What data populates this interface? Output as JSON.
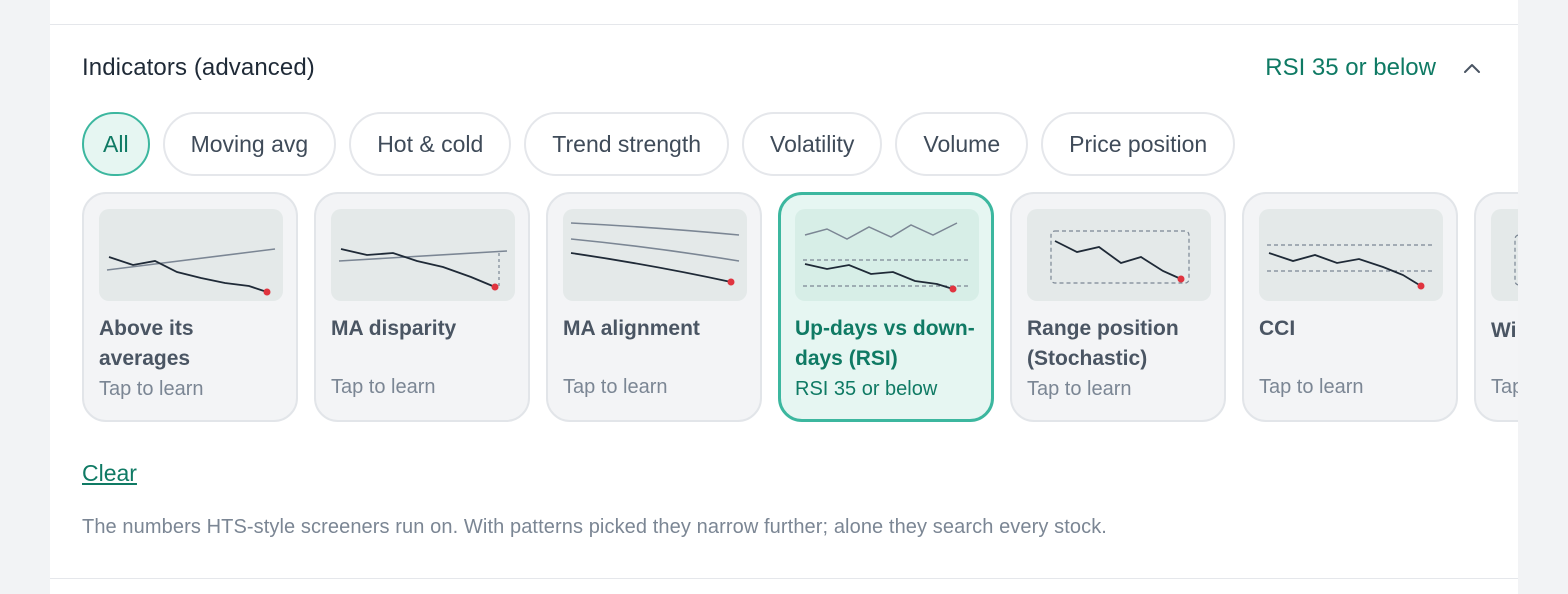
{
  "section": {
    "title": "Indicators (advanced)",
    "summary": "RSI 35 or below",
    "collapse_icon": "chevron-up-icon"
  },
  "chips": [
    {
      "label": "All",
      "active": true
    },
    {
      "label": "Moving avg",
      "active": false
    },
    {
      "label": "Hot & cold",
      "active": false
    },
    {
      "label": "Trend strength",
      "active": false
    },
    {
      "label": "Volatility",
      "active": false
    },
    {
      "label": "Volume",
      "active": false
    },
    {
      "label": "Price position",
      "active": false
    }
  ],
  "cards": [
    {
      "name": "Above its averages",
      "sub": "Tap to learn",
      "selected": false,
      "icon": "price-crossing-averages-icon"
    },
    {
      "name": "MA disparity",
      "sub": "Tap to learn",
      "selected": false,
      "icon": "ma-disparity-icon"
    },
    {
      "name": "MA alignment",
      "sub": "Tap to learn",
      "selected": false,
      "icon": "ma-alignment-icon"
    },
    {
      "name": "Up-days vs down-days (RSI)",
      "sub": "RSI 35 or below",
      "selected": true,
      "icon": "rsi-icon"
    },
    {
      "name": "Range position (Stochastic)",
      "sub": "Tap to learn",
      "selected": false,
      "icon": "stochastic-icon"
    },
    {
      "name": "CCI",
      "sub": "Tap to learn",
      "selected": false,
      "icon": "cci-icon"
    },
    {
      "name": "Wi",
      "sub": "Tap",
      "selected": false,
      "icon": "williams-icon"
    }
  ],
  "clear_label": "Clear",
  "help_text": "The numbers HTS-style screeners run on. With patterns picked they narrow further; alone they search every stock.",
  "colors": {
    "accent": "#0f7a64",
    "accent_border": "#3cb79f",
    "accent_bg": "#e6f6f2",
    "marker": "#e0343f",
    "line_dark": "#1f2a37",
    "line_gray": "#7b8694"
  }
}
